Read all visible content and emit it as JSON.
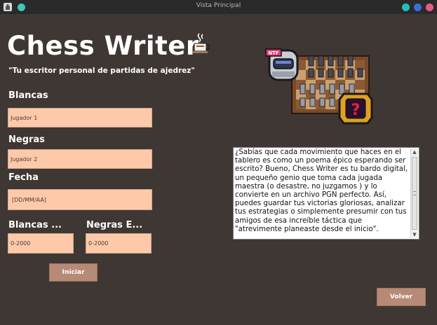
{
  "window": {
    "title": "Vista Principal",
    "dots": [
      "#1fc1c0",
      "#3a6fd8",
      "#e85a8a"
    ],
    "left_dot": "#3fc7b7"
  },
  "header": {
    "title": "Chess Writer",
    "tagline": "\"Tu escritor personal de partidas de ajedrez\""
  },
  "form": {
    "blancas_label": "Blancas",
    "blancas_placeholder": "Jugador 1",
    "negras_label": "Negras",
    "negras_placeholder": "Jugador 2",
    "fecha_label": "Fecha",
    "fecha_placeholder": "[DD/MM/AA]",
    "elo_blancas_label": "Blancas ...",
    "elo_blancas_placeholder": "0-2000",
    "elo_negras_label": "Negras E...",
    "elo_negras_placeholder": "0-2000"
  },
  "buttons": {
    "iniciar": "Iniciar",
    "volver": "Volver"
  },
  "info": {
    "text": "¿Sabías que cada movimiento que haces en el tablero es como un poema épico esperando ser escrito? Bueno, Chess Writer es tu bardo digital, un pequeño genio que toma cada  jugada maestra (o desastre, no juzgamos ) y lo convierte en un archivo PGN perfecto. Así, puedes guardar tus victorias  gloriosas, analizar tus estrategias o simplemente presumir  con tus amigos de esa increíble táctica que \"atrevimente planeaste desde el inicio\"."
  },
  "art": {
    "robot_badge": "NTF",
    "question_mark": "?"
  },
  "colors": {
    "background": "#3f3733",
    "field": "#fec9a9",
    "button": "#b68a75"
  }
}
